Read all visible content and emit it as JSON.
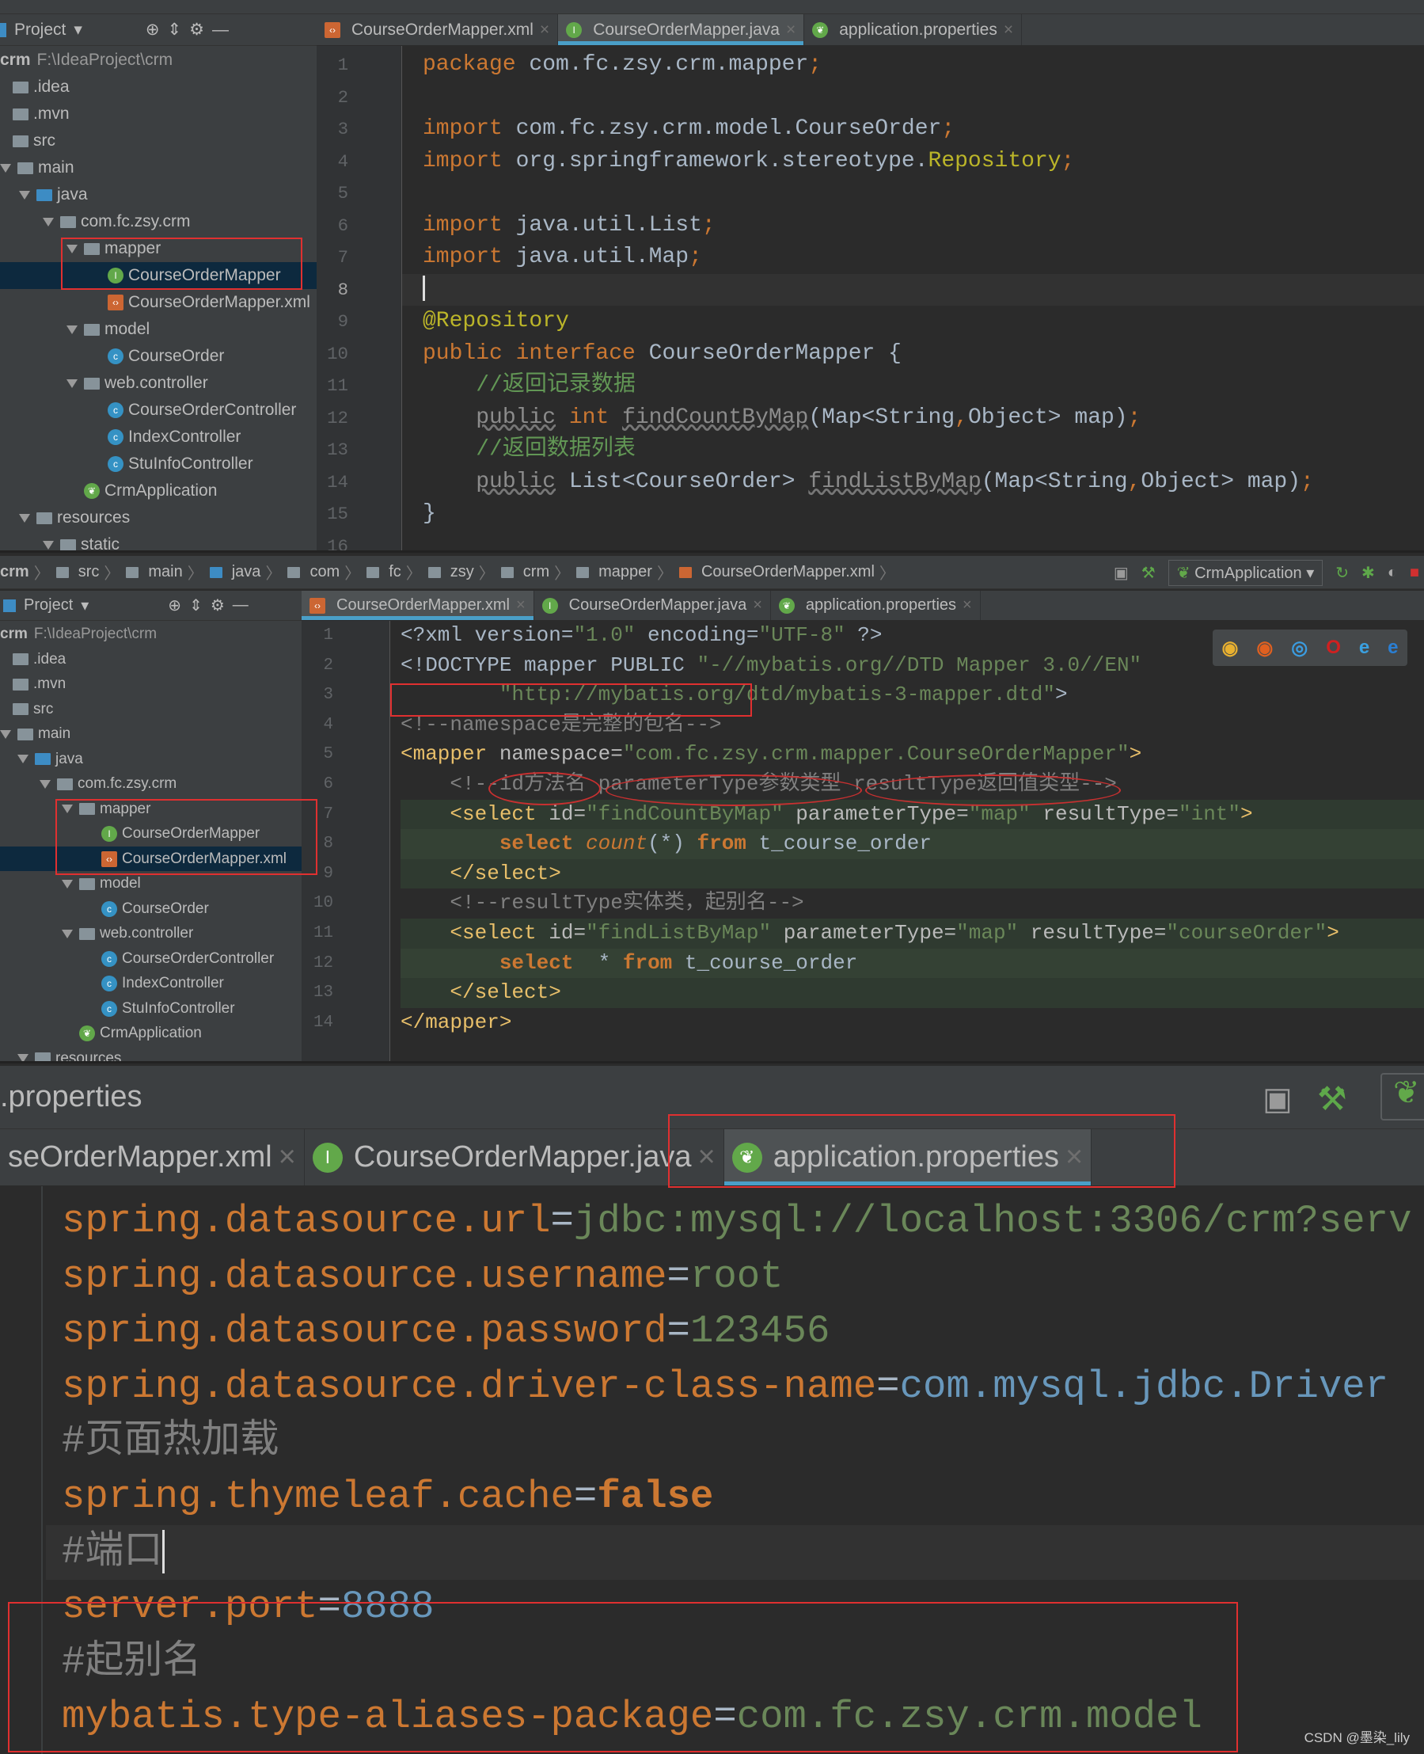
{
  "colors": {
    "keyword": "#cc7832",
    "string": "#6a8759",
    "comment": "#629755",
    "annotation": "#bbb529",
    "text": "#a9b7c6",
    "number": "#6897bb",
    "tag": "#e8bf6a",
    "accent": "#4a9fc8",
    "annotation_box": "#e03030"
  },
  "s1": {
    "sidebar_title": "Project",
    "tabs": [
      {
        "label": "CourseOrderMapper.xml",
        "icon": "xml-file-icon"
      },
      {
        "label": "CourseOrderMapper.java",
        "icon": "interface-icon",
        "active": true
      },
      {
        "label": "application.properties",
        "icon": "spring-icon"
      }
    ],
    "tree": [
      {
        "label": "crm",
        "extra": "F:\\IdeaProject\\crm",
        "level": 0,
        "icon": "none"
      },
      {
        "label": ".idea",
        "level": 1,
        "icon": "folder"
      },
      {
        "label": ".mvn",
        "level": 1,
        "icon": "folder"
      },
      {
        "label": "src",
        "level": 1,
        "icon": "folder"
      },
      {
        "label": "main",
        "level": 1,
        "icon": "folder",
        "expanded": true
      },
      {
        "label": "java",
        "level": 2,
        "icon": "folder-blue",
        "expanded": true
      },
      {
        "label": "com.fc.zsy.crm",
        "level": 3,
        "icon": "package",
        "expanded": true
      },
      {
        "label": "mapper",
        "level": 4,
        "icon": "package",
        "expanded": true
      },
      {
        "label": "CourseOrderMapper",
        "level": 5,
        "icon": "interface",
        "selected": true
      },
      {
        "label": "CourseOrderMapper.xml",
        "level": 5,
        "icon": "xml"
      },
      {
        "label": "model",
        "level": 4,
        "icon": "package",
        "expanded": true
      },
      {
        "label": "CourseOrder",
        "level": 5,
        "icon": "class"
      },
      {
        "label": "web.controller",
        "level": 4,
        "icon": "package",
        "expanded": true
      },
      {
        "label": "CourseOrderController",
        "level": 5,
        "icon": "class"
      },
      {
        "label": "IndexController",
        "level": 5,
        "icon": "class"
      },
      {
        "label": "StuInfoController",
        "level": 5,
        "icon": "class"
      },
      {
        "label": "CrmApplication",
        "level": 4,
        "icon": "spring"
      },
      {
        "label": "resources",
        "level": 2,
        "icon": "folder",
        "expanded": true
      },
      {
        "label": "static",
        "level": 3,
        "icon": "folder",
        "expanded": true
      }
    ],
    "code": [
      [
        [
          "kw",
          "package"
        ],
        [
          "tx",
          " com.fc.zsy.crm.mapper"
        ],
        [
          "kw",
          ";"
        ]
      ],
      [],
      [
        [
          "kw",
          "import"
        ],
        [
          "tx",
          " com.fc.zsy.crm.model.CourseOrder"
        ],
        [
          "kw",
          ";"
        ]
      ],
      [
        [
          "kw",
          "import"
        ],
        [
          "tx",
          " org.springframework.stereotype."
        ],
        [
          "an",
          "Repository"
        ],
        [
          "kw",
          ";"
        ]
      ],
      [],
      [
        [
          "kw",
          "import"
        ],
        [
          "tx",
          " java.util.List"
        ],
        [
          "kw",
          ";"
        ]
      ],
      [
        [
          "kw",
          "import"
        ],
        [
          "tx",
          " java.util.Map"
        ],
        [
          "kw",
          ";"
        ]
      ],
      [],
      [
        [
          "an",
          "@Repository"
        ]
      ],
      [
        [
          "kw",
          "public interface "
        ],
        [
          "tx",
          "CourseOrderMapper {"
        ]
      ],
      [
        [
          "tx",
          "    "
        ],
        [
          "cm",
          "//返回记录数据"
        ]
      ],
      [
        [
          "tx",
          "    "
        ],
        [
          "dim",
          "public"
        ],
        [
          "kw",
          " int "
        ],
        [
          "dim",
          "findCountByMap"
        ],
        [
          "tx",
          "(Map<String"
        ],
        [
          "kw",
          ","
        ],
        [
          "tx",
          "Object> map)"
        ],
        [
          "kw",
          ";"
        ]
      ],
      [
        [
          "tx",
          "    "
        ],
        [
          "cm",
          "//返回数据列表"
        ]
      ],
      [
        [
          "tx",
          "    "
        ],
        [
          "dim",
          "public"
        ],
        [
          "tx",
          " List<CourseOrder> "
        ],
        [
          "dim",
          "findListByMap"
        ],
        [
          "tx",
          "(Map<String"
        ],
        [
          "kw",
          ","
        ],
        [
          "tx",
          "Object> map)"
        ],
        [
          "kw",
          ";"
        ]
      ],
      [
        [
          "tx",
          "}"
        ]
      ],
      []
    ]
  },
  "s2": {
    "breadcrumb": [
      "crm",
      "src",
      "main",
      "java",
      "com",
      "fc",
      "zsy",
      "crm",
      "mapper",
      "CourseOrderMapper.xml"
    ],
    "run_config": "CrmApplication",
    "sidebar_title": "Project",
    "tabs": [
      {
        "label": "CourseOrderMapper.xml",
        "icon": "xml-file-icon",
        "active": true
      },
      {
        "label": "CourseOrderMapper.java",
        "icon": "interface-icon"
      },
      {
        "label": "application.properties",
        "icon": "spring-icon"
      }
    ],
    "tree": [
      {
        "label": "crm",
        "extra": "F:\\IdeaProject\\crm",
        "level": 0,
        "icon": "none"
      },
      {
        "label": ".idea",
        "level": 1,
        "icon": "folder"
      },
      {
        "label": ".mvn",
        "level": 1,
        "icon": "folder"
      },
      {
        "label": "src",
        "level": 1,
        "icon": "folder"
      },
      {
        "label": "main",
        "level": 1,
        "icon": "folder",
        "expanded": true
      },
      {
        "label": "java",
        "level": 2,
        "icon": "folder-blue",
        "expanded": true
      },
      {
        "label": "com.fc.zsy.crm",
        "level": 3,
        "icon": "package",
        "expanded": true
      },
      {
        "label": "mapper",
        "level": 4,
        "icon": "package",
        "expanded": true
      },
      {
        "label": "CourseOrderMapper",
        "level": 5,
        "icon": "interface"
      },
      {
        "label": "CourseOrderMapper.xml",
        "level": 5,
        "icon": "xml",
        "selected": true
      },
      {
        "label": "model",
        "level": 4,
        "icon": "package",
        "expanded": true
      },
      {
        "label": "CourseOrder",
        "level": 5,
        "icon": "class"
      },
      {
        "label": "web.controller",
        "level": 4,
        "icon": "package",
        "expanded": true
      },
      {
        "label": "CourseOrderController",
        "level": 5,
        "icon": "class"
      },
      {
        "label": "IndexController",
        "level": 5,
        "icon": "class"
      },
      {
        "label": "StuInfoController",
        "level": 5,
        "icon": "class"
      },
      {
        "label": "CrmApplication",
        "level": 4,
        "icon": "spring"
      },
      {
        "label": "resources",
        "level": 2,
        "icon": "folder",
        "expanded": true
      }
    ],
    "browsers": [
      "chrome",
      "firefox",
      "safari",
      "opera",
      "ie",
      "edge"
    ],
    "code": [
      [
        [
          "tx",
          "<?xml version="
        ],
        [
          "st",
          "\"1.0\""
        ],
        [
          "tx",
          " encoding="
        ],
        [
          "st",
          "\"UTF-8\""
        ],
        [
          "tx",
          " ?>"
        ]
      ],
      [
        [
          "tx",
          "<!DOCTYPE mapper PUBLIC "
        ],
        [
          "st",
          "\"-//mybatis.org//DTD Mapper 3.0//EN\""
        ]
      ],
      [
        [
          "st",
          "        \"http://mybatis.org/dtd/mybatis-3-mapper.dtd\""
        ],
        [
          "tx",
          ">"
        ]
      ],
      [
        [
          "cmg",
          "<!--namespace是完整的包名-->"
        ]
      ],
      [
        [
          "tg",
          "<mapper"
        ],
        [
          "at",
          " namespace="
        ],
        [
          "st",
          "\"com.fc.zsy.crm.mapper.CourseOrderMapper\""
        ],
        [
          "tg",
          ">"
        ]
      ],
      [
        [
          "cmg",
          "    <!--id方法名 parameterType参数类型 resultType返回值类型-->"
        ]
      ],
      [
        [
          "tg",
          "    <select"
        ],
        [
          "at",
          " id="
        ],
        [
          "st",
          "\"findCountByMap\""
        ],
        [
          "at",
          " parameterType="
        ],
        [
          "st",
          "\"map\""
        ],
        [
          "at",
          " resultType="
        ],
        [
          "st",
          "\"int\""
        ],
        [
          "tg",
          ">"
        ]
      ],
      [
        [
          "sq",
          "        select "
        ],
        [
          "it",
          "count"
        ],
        [
          "tx",
          "(*) "
        ],
        [
          "sq",
          "from"
        ],
        [
          "tx",
          " t_course_order"
        ]
      ],
      [
        [
          "tg",
          "    </select>"
        ]
      ],
      [
        [
          "cmg",
          "    <!--resultType实体类，起别名-->"
        ]
      ],
      [
        [
          "tg",
          "    <select"
        ],
        [
          "at",
          " id="
        ],
        [
          "st",
          "\"findListByMap\""
        ],
        [
          "at",
          " parameterType="
        ],
        [
          "st",
          "\"map\""
        ],
        [
          "at",
          " resultType="
        ],
        [
          "st",
          "\"courseOrder\""
        ],
        [
          "tg",
          ">"
        ]
      ],
      [
        [
          "sq",
          "        select"
        ],
        [
          "tx",
          "  * "
        ],
        [
          "sq",
          "from"
        ],
        [
          "tx",
          " t_course_order"
        ]
      ],
      [
        [
          "tg",
          "    </select>"
        ]
      ],
      [
        [
          "tg",
          "</mapper>"
        ]
      ]
    ]
  },
  "s3": {
    "window_title": ".properties",
    "tabs": [
      {
        "label": "seOrderMapper.xml",
        "icon": "none"
      },
      {
        "label": "CourseOrderMapper.java",
        "icon": "interface-icon"
      },
      {
        "label": "application.properties",
        "icon": "spring-icon",
        "active": true
      }
    ],
    "code": [
      [
        [
          "kw",
          "spring.datasource.url"
        ],
        [
          "tx",
          "="
        ],
        [
          "st",
          "jdbc:mysql://localhost:3306/crm?serv"
        ]
      ],
      [
        [
          "kw",
          "spring.datasource.username"
        ],
        [
          "tx",
          "="
        ],
        [
          "st",
          "root"
        ]
      ],
      [
        [
          "kw",
          "spring.datasource.password"
        ],
        [
          "tx",
          "="
        ],
        [
          "st",
          "123456"
        ]
      ],
      [
        [
          "kw",
          "spring.datasource.driver-class-name"
        ],
        [
          "tx",
          "="
        ],
        [
          "nu",
          "com.mysql.jdbc.Driver"
        ]
      ],
      [
        [
          "cmg",
          "#页面热加载"
        ]
      ],
      [
        [
          "kw",
          "spring.thymeleaf.cache"
        ],
        [
          "tx",
          "="
        ],
        [
          "sq",
          "false"
        ]
      ],
      [
        [
          "cmg",
          "#端口"
        ]
      ],
      [
        [
          "kw",
          "server.port"
        ],
        [
          "tx",
          "="
        ],
        [
          "nu",
          "8888"
        ]
      ],
      [
        [
          "cmg",
          "#起别名"
        ]
      ],
      [
        [
          "kw",
          "mybatis.type-aliases-package"
        ],
        [
          "tx",
          "="
        ],
        [
          "st",
          "com.fc.zsy.crm.model"
        ]
      ]
    ]
  },
  "watermark": "CSDN @墨染_lily"
}
